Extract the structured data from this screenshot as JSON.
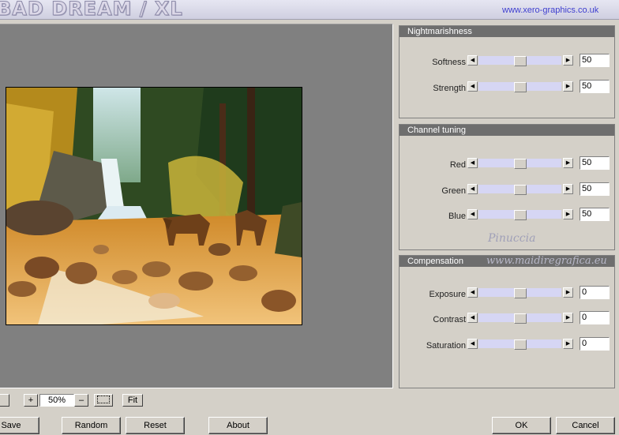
{
  "header": {
    "title": "BAD DREAM / XL",
    "website": "www.xero-graphics.co.uk"
  },
  "groups": [
    {
      "title": "Nightmarishness",
      "rows": [
        {
          "label": "Softness",
          "value": "50",
          "level": 0.5
        },
        {
          "label": "Strength",
          "value": "50",
          "level": 0.5
        }
      ]
    },
    {
      "title": "Channel tuning",
      "rows": [
        {
          "label": "Red",
          "value": "50",
          "level": 0.5
        },
        {
          "label": "Green",
          "value": "50",
          "level": 0.5
        },
        {
          "label": "Blue",
          "value": "50",
          "level": 0.5
        }
      ]
    },
    {
      "title": "Compensation",
      "rows": [
        {
          "label": "Exposure",
          "value": "0",
          "level": 0.5
        },
        {
          "label": "Contrast",
          "value": "0",
          "level": 0.5
        },
        {
          "label": "Saturation",
          "value": "0",
          "level": 0.5
        }
      ]
    }
  ],
  "watermarks": {
    "name": "Pinuccia",
    "site": "www.maidiregrafica.eu"
  },
  "zoom": {
    "plus": "+",
    "value": "50%",
    "minus": "–",
    "fit": "Fit"
  },
  "buttons": {
    "save": "Save",
    "random": "Random",
    "reset": "Reset",
    "about": "About",
    "ok": "OK",
    "cancel": "Cancel"
  },
  "colors": {
    "slider_track": "#d6d6f4",
    "group_header": "#6e6e6e",
    "preview_bg": "#808080"
  }
}
